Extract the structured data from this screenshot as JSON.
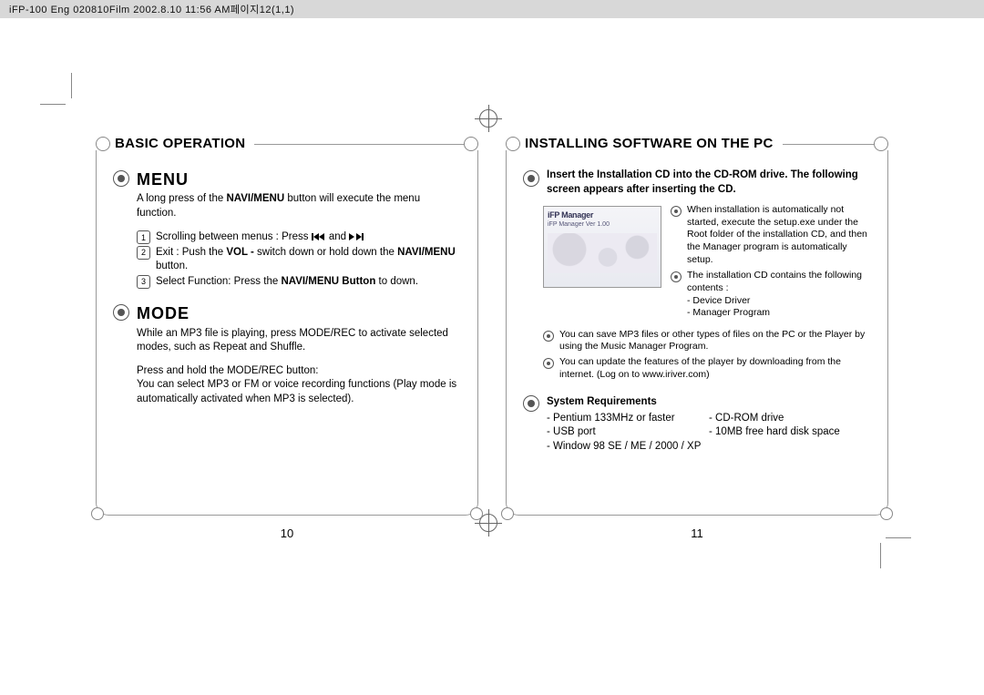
{
  "header": "iFP-100 Eng 020810Film  2002.8.10 11:56 AM페이지12(1,1)",
  "left": {
    "title": "BASIC OPERATION",
    "page_num": "10",
    "menu": {
      "heading": "MENU",
      "intro_a": "A long press of the ",
      "intro_b": "NAVI/MENU",
      "intro_c": " button will execute the menu function.",
      "items": [
        {
          "n": "1",
          "text_a": "Scrolling between menus : Press ",
          "text_b": " and "
        },
        {
          "n": "2",
          "text_a": "Exit : Push the ",
          "bold": "VOL -",
          "text_b": " switch down or hold down the ",
          "bold2": "NAVI/MENU",
          "text_c": " button."
        },
        {
          "n": "3",
          "text_a": "Select Function: Press the ",
          "bold": "NAVI/MENU Button",
          "text_b": " to down."
        }
      ]
    },
    "mode": {
      "heading": "MODE",
      "p1": "While an MP3 file is playing, press MODE/REC to activate selected modes, such as Repeat and Shuffle.",
      "p2": "Press and hold the MODE/REC button:",
      "p3": "You can select MP3 or FM or voice recording functions (Play mode is automatically activated when MP3 is selected)."
    }
  },
  "right": {
    "title": "INSTALLING SOFTWARE ON THE PC",
    "page_num": "11",
    "intro": "Insert the Installation CD into the CD-ROM drive. The following screen appears after inserting the CD.",
    "screenshot": {
      "title": "iFP Manager",
      "sub": "iFP Manager  Ver 1.00"
    },
    "bullets_small": [
      "When installation is automatically not started, execute the setup.exe under the Root folder of the installation CD, and then the Manager program is automatically setup.",
      "The installation CD contains the following contents :\n- Device Driver\n- Manager Program"
    ],
    "bullets_wide": [
      "You can save MP3 files or other types of files on the PC or the Player by using the Music Manager Program.",
      "You can update the features of the player by downloading from the internet. (Log on to www.iriver.com)"
    ],
    "sysreq": {
      "heading": "System Requirements",
      "left": [
        "- Pentium 133MHz or faster",
        "- USB port",
        "- Window 98 SE / ME / 2000 / XP"
      ],
      "right": [
        "- CD-ROM drive",
        "- 10MB free hard disk space"
      ]
    }
  }
}
